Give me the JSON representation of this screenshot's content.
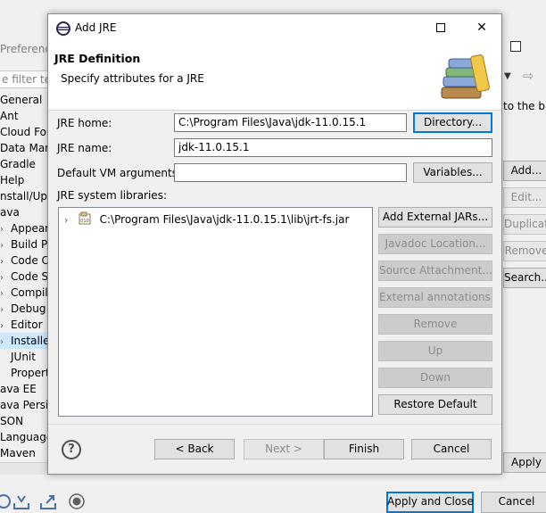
{
  "background_window": {
    "title": "Preference",
    "filter_placeholder": "e filter text",
    "tree": [
      {
        "label": "General",
        "indent": 0,
        "chevron": ""
      },
      {
        "label": "Ant",
        "indent": 0,
        "chevron": ""
      },
      {
        "label": "Cloud Foun",
        "indent": 0,
        "chevron": ""
      },
      {
        "label": "Data Mana",
        "indent": 0,
        "chevron": ""
      },
      {
        "label": "Gradle",
        "indent": 0,
        "chevron": ""
      },
      {
        "label": "Help",
        "indent": 0,
        "chevron": ""
      },
      {
        "label": "nstall/Upd",
        "indent": 0,
        "chevron": ""
      },
      {
        "label": "ava",
        "indent": 0,
        "chevron": ""
      },
      {
        "label": "Appeara",
        "indent": 1,
        "chevron": "›"
      },
      {
        "label": "Build Pa",
        "indent": 1,
        "chevron": "›"
      },
      {
        "label": "Code C",
        "indent": 1,
        "chevron": "›"
      },
      {
        "label": "Code St",
        "indent": 1,
        "chevron": "›"
      },
      {
        "label": "Compile",
        "indent": 1,
        "chevron": "›"
      },
      {
        "label": "Debug",
        "indent": 1,
        "chevron": "›"
      },
      {
        "label": "Editor",
        "indent": 1,
        "chevron": "›"
      },
      {
        "label": "Installed",
        "indent": 1,
        "chevron": "›",
        "selected": true
      },
      {
        "label": "JUnit",
        "indent": 1,
        "chevron": ""
      },
      {
        "label": "Properti",
        "indent": 1,
        "chevron": ""
      },
      {
        "label": "ava EE",
        "indent": 0,
        "chevron": ""
      },
      {
        "label": "ava Persist",
        "indent": 0,
        "chevron": ""
      },
      {
        "label": "SON",
        "indent": 0,
        "chevron": ""
      },
      {
        "label": "Language",
        "indent": 0,
        "chevron": ""
      },
      {
        "label": "Maven",
        "indent": 0,
        "chevron": ""
      }
    ],
    "right_text": "to the bu",
    "right_buttons": {
      "add": "Add...",
      "edit": "Edit...",
      "duplicate": "Duplicate",
      "remove": "Remove",
      "search": "Search...",
      "apply": "Apply"
    },
    "apply_and_close": "Apply and Close",
    "cancel": "Cancel"
  },
  "dialog": {
    "title": "Add JRE",
    "header_title": "JRE Definition",
    "header_subtitle": "Specify attributes for a JRE",
    "jre_home_label": "JRE home:",
    "jre_home_value": "C:\\Program Files\\Java\\jdk-11.0.15.1",
    "directory_button": "Directory...",
    "jre_name_label": "JRE name:",
    "jre_name_value": "jdk-11.0.15.1",
    "vm_args_label": "Default VM arguments:",
    "vm_args_value": "",
    "variables_button": "Variables...",
    "system_libraries_label": "JRE system libraries:",
    "library_entry": "C:\\Program Files\\Java\\jdk-11.0.15.1\\lib\\jrt-fs.jar",
    "side_buttons": {
      "add_external_jars": "Add External JARs...",
      "javadoc_location": "Javadoc Location...",
      "source_attachment": "Source Attachment...",
      "external_annotations": "External annotations...",
      "remove": "Remove",
      "up": "Up",
      "down": "Down",
      "restore_default": "Restore Default"
    },
    "footer_buttons": {
      "back": "< Back",
      "next": "Next >",
      "finish": "Finish",
      "cancel": "Cancel"
    }
  }
}
